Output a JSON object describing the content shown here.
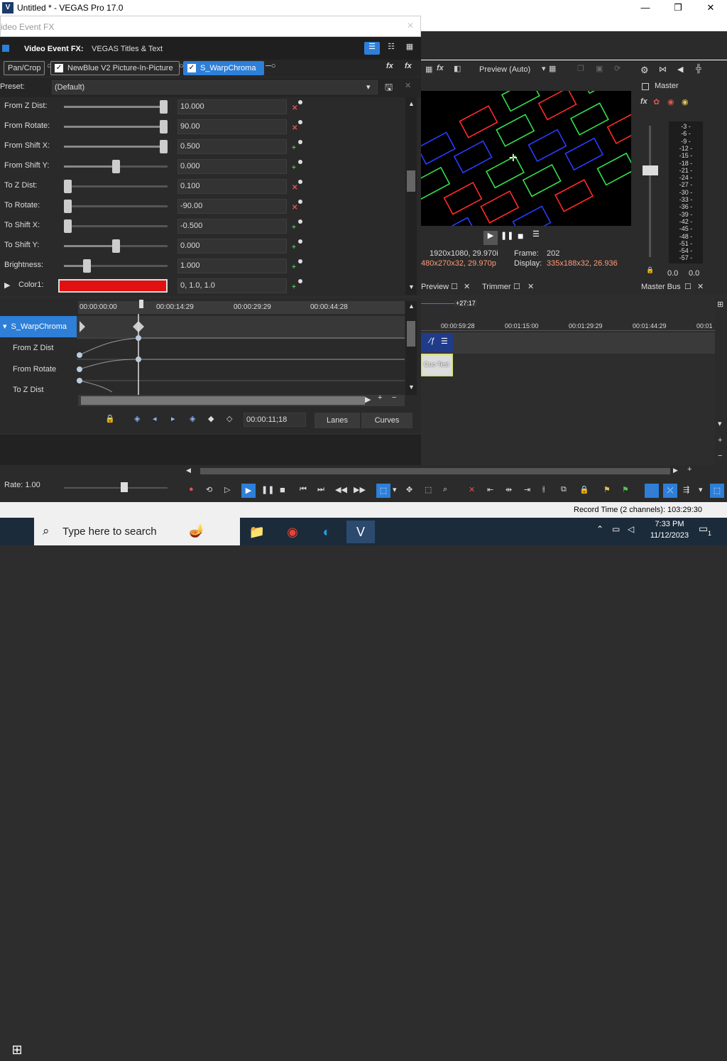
{
  "app": {
    "title": "Untitled * - VEGAS Pro 17.0",
    "logo_letter": "V",
    "win_controls": {
      "minimize": "—",
      "maximize": "❐",
      "close": "✕"
    }
  },
  "vef": {
    "window_title": "ideo Event FX",
    "header_label": "Video Event FX:",
    "header_value": "VEGAS Titles & Text",
    "chain": [
      {
        "label": "Pan/Crop",
        "checked": false
      },
      {
        "label": "NewBlue V2 Picture-In-Picture",
        "checked": true
      },
      {
        "label": "S_WarpChroma",
        "checked": true
      }
    ],
    "preset_label": "Preset:",
    "preset_value": "(Default)",
    "params": [
      {
        "label": "From Z Dist:",
        "value": "10.000",
        "slider": 1.0,
        "kf": "x"
      },
      {
        "label": "From Rotate:",
        "value": "90.00",
        "slider": 1.0,
        "kf": "x"
      },
      {
        "label": "From Shift X:",
        "value": "0.500",
        "slider": 1.0,
        "kf": "p"
      },
      {
        "label": "From Shift Y:",
        "value": "0.000",
        "slider": 0.5,
        "kf": "p"
      },
      {
        "label": "To Z Dist:",
        "value": "0.100",
        "slider": 0.0,
        "kf": "x"
      },
      {
        "label": "To Rotate:",
        "value": "-90.00",
        "slider": 0.0,
        "kf": "x"
      },
      {
        "label": "To Shift X:",
        "value": "-0.500",
        "slider": 0.0,
        "kf": "p"
      },
      {
        "label": "To Shift Y:",
        "value": "0.000",
        "slider": 0.5,
        "kf": "p"
      },
      {
        "label": "Brightness:",
        "value": "1.000",
        "slider": 0.2,
        "kf": "p"
      },
      {
        "label": "Color1:",
        "value": "0, 1.0, 1.0",
        "color": "#e11111",
        "kf": "p"
      }
    ],
    "ruler_ticks": [
      "00:00:00:00",
      "00:00:14:29",
      "00:00:29:29",
      "00:00:44:28"
    ],
    "kf_tracks": [
      "S_WarpChroma",
      "From Z Dist",
      "From Rotate",
      "To Z Dist"
    ],
    "timecode": "00:00:11;18",
    "tab_lanes": "Lanes",
    "tab_curves": "Curves"
  },
  "preview": {
    "toolbar_label": "Preview (Auto)",
    "project_label": "1920x1080, 29.970i",
    "preview_label": "480x270x32, 29.970p",
    "frame_label": "Frame:",
    "frame_value": "202",
    "display_label": "Display:",
    "display_value": "335x188x32, 26.936",
    "tab_preview": "Preview",
    "tab_trimmer": "Trimmer"
  },
  "master": {
    "label": "Master",
    "scale": [
      "3",
      "6",
      "9",
      "12",
      "15",
      "18",
      "21",
      "24",
      "27",
      "30",
      "33",
      "36",
      "39",
      "42",
      "45",
      "48",
      "51",
      "54",
      "57"
    ],
    "left_val": "0.0",
    "right_val": "0.0",
    "bus_tab": "Master Bus"
  },
  "timeline": {
    "marker": "+27:17",
    "ticks": [
      "00:00:59:28",
      "00:01:15:00",
      "00:01:29:29",
      "00:01:44:29",
      "00:01"
    ],
    "clip_label": "Cuc-Test"
  },
  "transport": {
    "rate_label": "Rate: 1.00"
  },
  "status": {
    "record_time": "Record Time (2 channels): 103:29:30"
  },
  "taskbar": {
    "search_placeholder": "Type here to search",
    "time": "7:33 PM",
    "date": "11/12/2023",
    "notif_count": "1"
  }
}
